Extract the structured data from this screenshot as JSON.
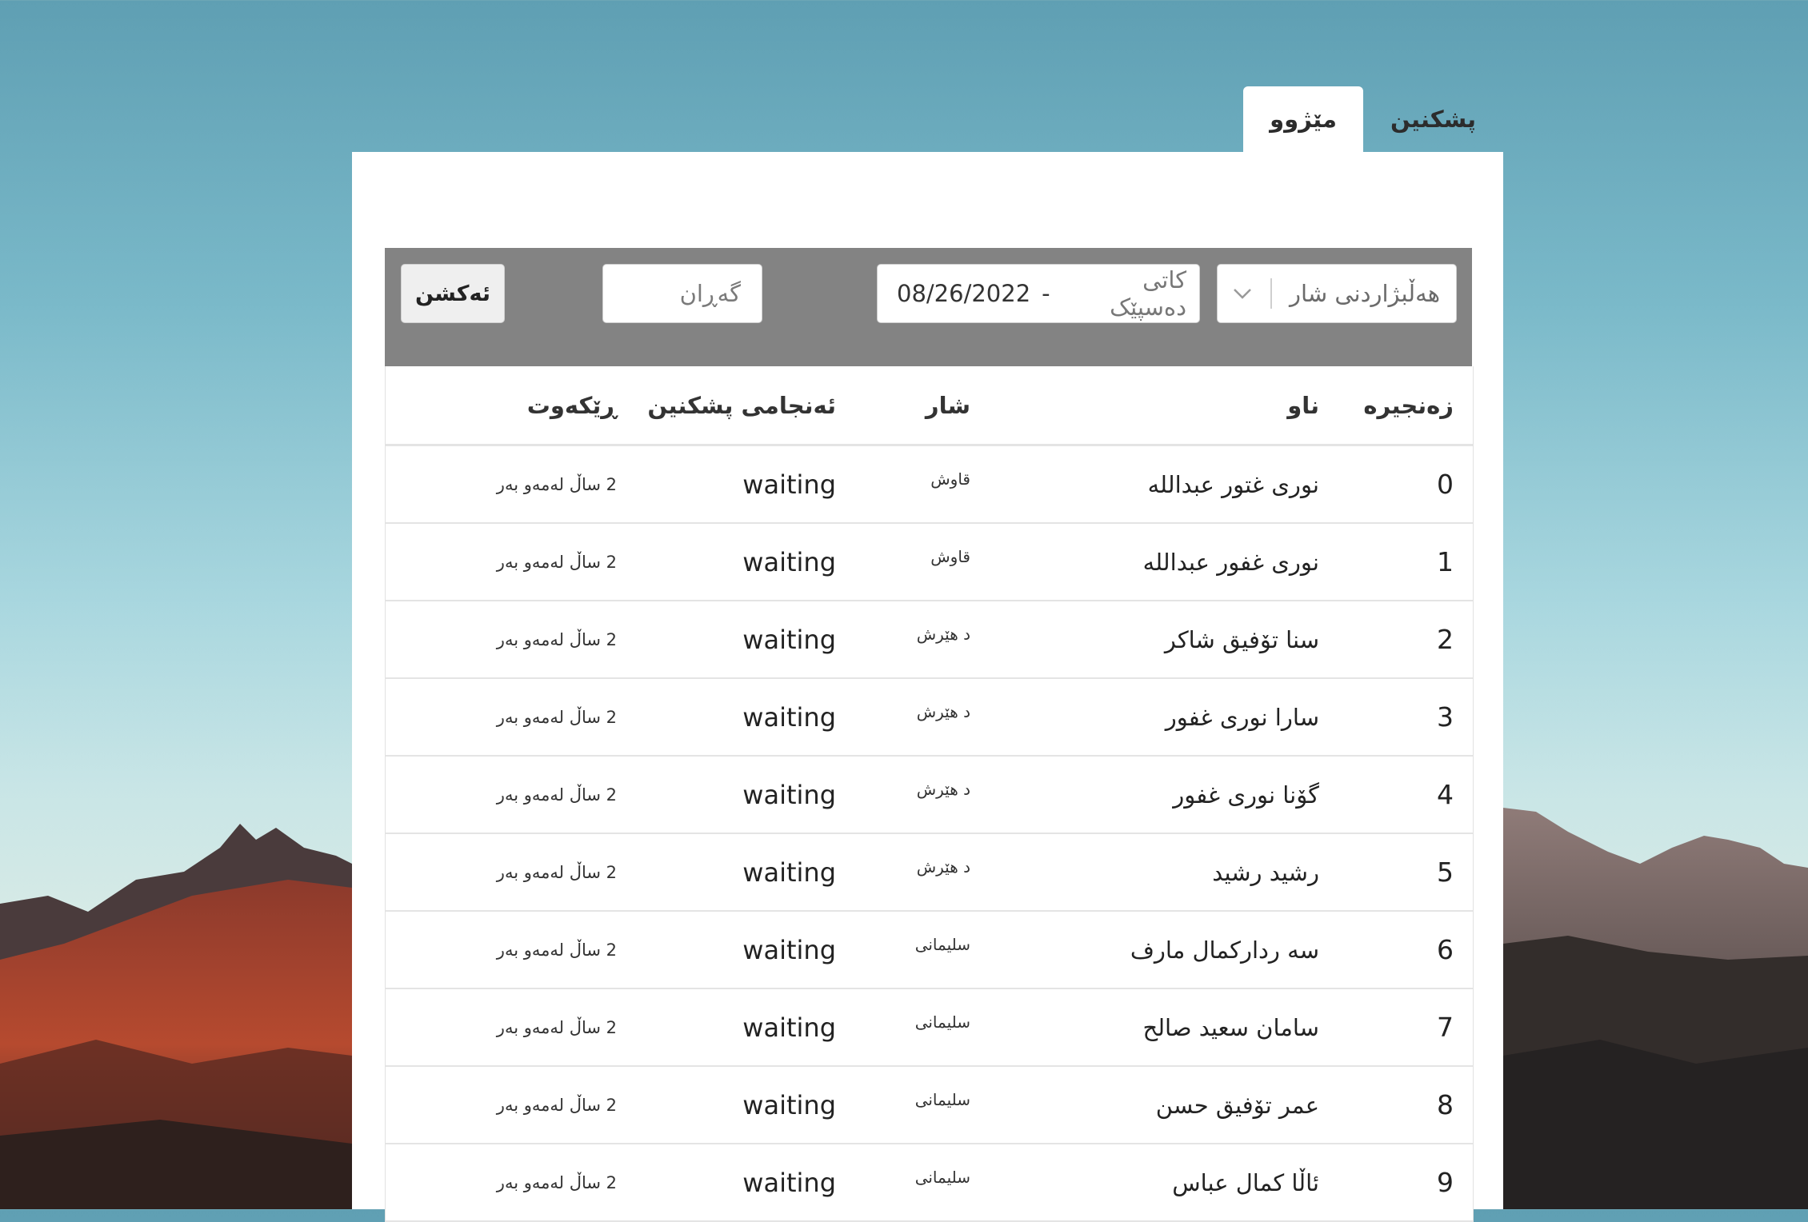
{
  "tabs": [
    {
      "label": "پشکنین",
      "active": false
    },
    {
      "label": "مێژوو",
      "active": true
    }
  ],
  "filters": {
    "city_placeholder": "هەڵبژاردنی شار",
    "date_start_placeholder": "کاتی دەسپێک",
    "date_end_value": "08/26/2022",
    "date_separator": "-",
    "search_placeholder": "گەڕان",
    "action_label": "ئەکشن"
  },
  "table": {
    "headers": {
      "index": "زەنجیرە",
      "name": "ناو",
      "city": "شار",
      "result": "ئەنجامی پشکنین",
      "date": "ڕێکەوت"
    },
    "rows": [
      {
        "index": "0",
        "name": "نوری غتور عبداللە",
        "city": "قاوش",
        "result": "waiting",
        "date": "2 ساڵ لەمەو بەر"
      },
      {
        "index": "1",
        "name": "نوری غفور عبداللە",
        "city": "قاوش",
        "result": "waiting",
        "date": "2 ساڵ لەمەو بەر"
      },
      {
        "index": "2",
        "name": "سنا تۆفیق شاکر",
        "city": "د هێرش",
        "result": "waiting",
        "date": "2 ساڵ لەمەو بەر"
      },
      {
        "index": "3",
        "name": "سارا نوری غفور",
        "city": "د هێرش",
        "result": "waiting",
        "date": "2 ساڵ لەمەو بەر"
      },
      {
        "index": "4",
        "name": "گۆنا نوری غفور",
        "city": "د هێرش",
        "result": "waiting",
        "date": "2 ساڵ لەمەو بەر"
      },
      {
        "index": "5",
        "name": "رشید رشید",
        "city": "د هێرش",
        "result": "waiting",
        "date": "2 ساڵ لەمەو بەر"
      },
      {
        "index": "6",
        "name": "سه ردارکمال مارف",
        "city": "سلیمانی",
        "result": "waiting",
        "date": "2 ساڵ لەمەو بەر"
      },
      {
        "index": "7",
        "name": "سامان سعید صالح",
        "city": "سلیمانی",
        "result": "waiting",
        "date": "2 ساڵ لەمەو بەر"
      },
      {
        "index": "8",
        "name": "عمر تۆفیق حسن",
        "city": "سلیمانی",
        "result": "waiting",
        "date": "2 ساڵ لەمەو بەر"
      },
      {
        "index": "9",
        "name": "ئاڵا کمال عباس",
        "city": "سلیمانی",
        "result": "waiting",
        "date": "2 ساڵ لەمەو بەر"
      }
    ]
  },
  "colors": {
    "toolbar_bg": "#838383",
    "panel_bg": "#ffffff",
    "sky_top": "#5f9fb3",
    "mountain_rock": "#5a4a48",
    "mountain_red": "#b3442b"
  },
  "icons": {
    "city_dropdown": "chevron-down-icon"
  }
}
